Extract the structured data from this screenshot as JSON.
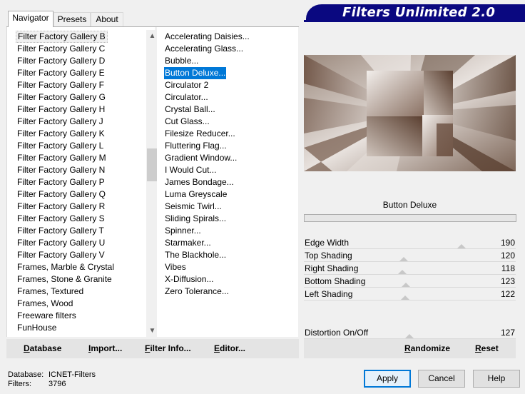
{
  "tabs": [
    {
      "label": "Navigator",
      "active": true
    },
    {
      "label": "Presets",
      "active": false
    },
    {
      "label": "About",
      "active": false
    }
  ],
  "title": "Filters Unlimited 2.0",
  "categories": [
    "Filter Factory Gallery B",
    "Filter Factory Gallery C",
    "Filter Factory Gallery D",
    "Filter Factory Gallery E",
    "Filter Factory Gallery F",
    "Filter Factory Gallery G",
    "Filter Factory Gallery H",
    "Filter Factory Gallery J",
    "Filter Factory Gallery K",
    "Filter Factory Gallery L",
    "Filter Factory Gallery M",
    "Filter Factory Gallery N",
    "Filter Factory Gallery P",
    "Filter Factory Gallery Q",
    "Filter Factory Gallery R",
    "Filter Factory Gallery S",
    "Filter Factory Gallery T",
    "Filter Factory Gallery U",
    "Filter Factory Gallery V",
    "Frames, Marble & Crystal",
    "Frames, Stone & Granite",
    "Frames, Textured",
    "Frames, Wood",
    "Freeware filters",
    "FunHouse"
  ],
  "filters": [
    "Accelerating Daisies...",
    "Accelerating Glass...",
    "Bubble...",
    "Button Deluxe...",
    "Circulator 2",
    "Circulator...",
    "Crystal Ball...",
    "Cut Glass...",
    "Filesize Reducer...",
    "Fluttering Flag...",
    "Gradient Window...",
    "I Would Cut...",
    "James Bondage...",
    "Luma Greyscale",
    "Seismic Twirl...",
    "Sliding Spirals...",
    "Spinner...",
    "Starmaker...",
    "The Blackhole...",
    "Vibes",
    "X-Diffusion...",
    "Zero Tolerance..."
  ],
  "selected_filter": "Button Deluxe...",
  "filter_name": "Button Deluxe",
  "parameters": [
    {
      "label": "Edge Width",
      "value": "190",
      "fraction": 0.745
    },
    {
      "label": "Top Shading",
      "value": "120",
      "fraction": 0.47
    },
    {
      "label": "Right Shading",
      "value": "118",
      "fraction": 0.463
    },
    {
      "label": "Bottom Shading",
      "value": "123",
      "fraction": 0.482
    },
    {
      "label": "Left Shading",
      "value": "122",
      "fraction": 0.478
    },
    {
      "label": "Distortion On/Off",
      "value": "127",
      "fraction": 0.498
    }
  ],
  "commands_left": [
    {
      "label": "Database",
      "underline": "D",
      "rest": "atabase"
    },
    {
      "label": "Import...",
      "underline": "I",
      "rest": "mport..."
    },
    {
      "label": "Filter Info...",
      "underline": "F",
      "rest": "ilter Info..."
    },
    {
      "label": "Editor...",
      "underline": "E",
      "rest": "ditor..."
    }
  ],
  "commands_right": [
    {
      "label": "Randomize",
      "underline": "R",
      "rest": "andomize"
    },
    {
      "label": "Reset",
      "underline": "R",
      "rest": "eset"
    }
  ],
  "status": {
    "database_label": "Database:",
    "database_value": "ICNET-Filters",
    "filters_label": "Filters:",
    "filters_value": "3796"
  },
  "buttons": {
    "apply": "Apply",
    "cancel": "Cancel",
    "help": "Help"
  },
  "colors": {
    "title_bg": "#0a0880",
    "selection": "#0078d7",
    "preview_tone": "#8a7060"
  },
  "icons": {
    "scroll_up": "▲",
    "scroll_down": "▼"
  }
}
